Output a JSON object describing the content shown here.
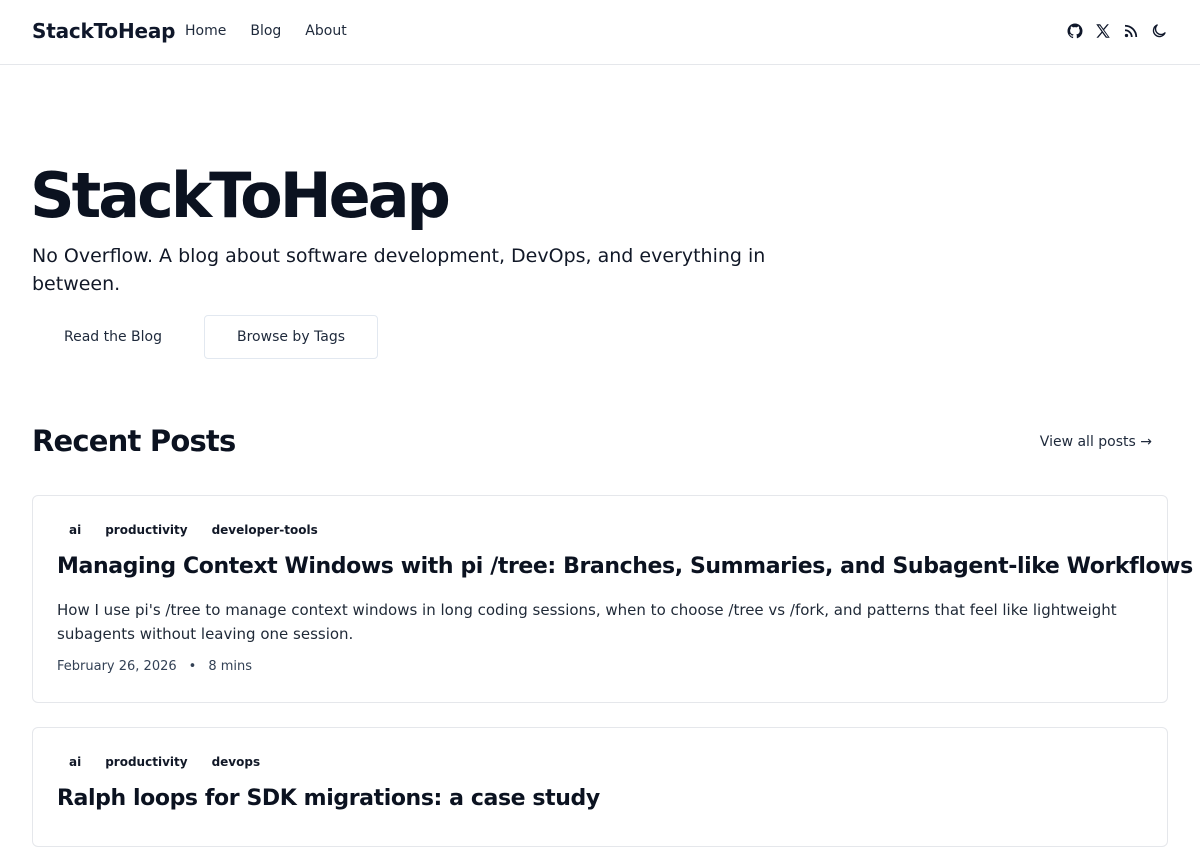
{
  "header": {
    "brand": "StackToHeap",
    "nav": [
      "Home",
      "Blog",
      "About"
    ],
    "icons": [
      "github-icon",
      "x-icon",
      "rss-icon",
      "moon-icon"
    ]
  },
  "hero": {
    "title": "StackToHeap",
    "subtitle": "No Overflow. A blog about software development, DevOps, and everything in between.",
    "primary_button": "Read the Blog",
    "secondary_button": "Browse by Tags"
  },
  "recent": {
    "title": "Recent Posts",
    "view_all": "View all posts →"
  },
  "posts": [
    {
      "tags": [
        "ai",
        "productivity",
        "developer-tools"
      ],
      "title": "Managing Context Windows with pi /tree: Branches, Summaries, and Subagent-like Workflows",
      "description": "How I use pi's /tree to manage context windows in long coding sessions, when to choose /tree vs /fork, and patterns that feel like lightweight subagents without leaving one session.",
      "date": "February 26, 2026",
      "separator": "•",
      "read_time": "8 mins"
    },
    {
      "tags": [
        "ai",
        "productivity",
        "devops"
      ],
      "title": "Ralph loops for SDK migrations: a case study"
    }
  ]
}
